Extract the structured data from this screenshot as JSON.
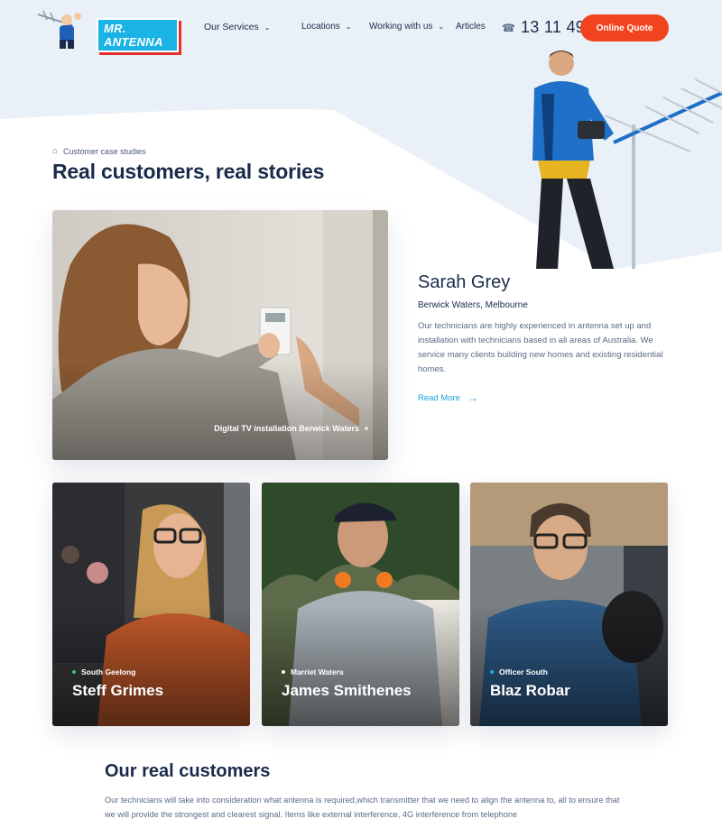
{
  "brand": {
    "logo_text": "MR. ANTENNA",
    "accent": "#f2431f",
    "brand_blue": "#19b3e6",
    "link_color": "#19a0dc"
  },
  "nav": {
    "items": [
      {
        "label": "Our Services",
        "has_dropdown": true
      },
      {
        "label": "Locations",
        "has_dropdown": true
      },
      {
        "label": "Working with us",
        "has_dropdown": true
      },
      {
        "label": "Articles",
        "has_dropdown": false
      }
    ],
    "phone": "13 11 49",
    "cta_label": "Online Quote"
  },
  "page": {
    "breadcrumb": "Customer case studies",
    "title": "Real customers, real stories"
  },
  "featured": {
    "name": "Sarah Grey",
    "location": "Berwick Waters, Melbourne",
    "description": "Our technicians are highly experienced in antenna set up and installation with technicians based in all areas of Australia. We service many clients building new homes and existing residential homes.",
    "read_more": "Read More",
    "caption": "Digital TV installation  Berwick Waters"
  },
  "cards": [
    {
      "location": "South Geelong",
      "name": "Steff Grimes",
      "dot_color": "#3ec46d"
    },
    {
      "location": "Marriet Waters",
      "name": "James Smithenes",
      "dot_color": "#ffffff"
    },
    {
      "location": "Officer South",
      "name": "Blaz Robar",
      "dot_color": "#19b3e6"
    }
  ],
  "section": {
    "title": "Our real customers",
    "text": "Our technicians will take into consideration what antenna is required,which transmitter that we need to align the antenna to, all to ensure that we will provide the strongest and clearest signal. Items like external interference, 4G interference from telephone"
  }
}
